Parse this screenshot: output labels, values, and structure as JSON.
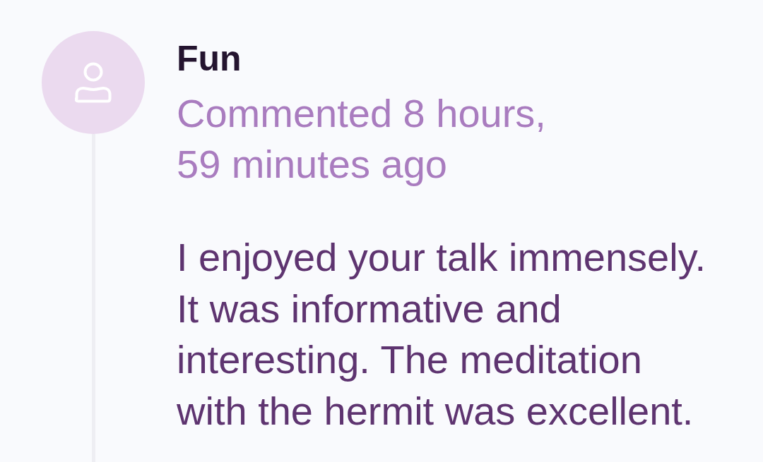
{
  "comment": {
    "author": "Fun",
    "meta": "Commented 8 hours, 59 minutes ago",
    "text": "I enjoyed your talk immensely. It was informative and interesting. The meditation with the hermit was excellent."
  }
}
